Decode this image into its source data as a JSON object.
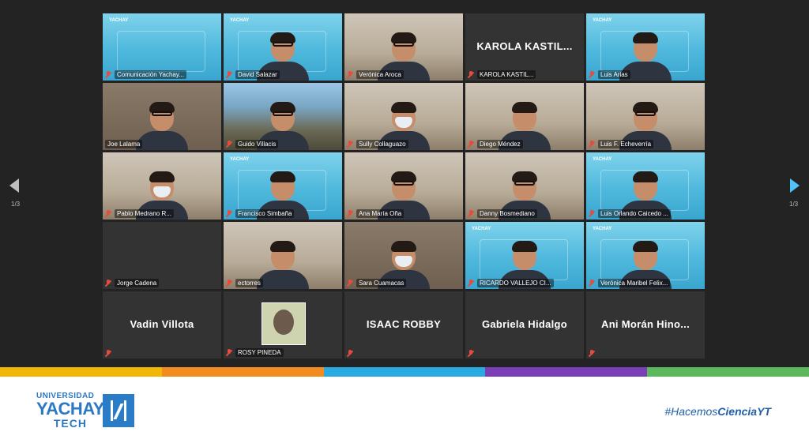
{
  "participants": [
    {
      "name": "Comunicación Yachay...",
      "muted": true,
      "bg": "brand",
      "person": false,
      "logo": true
    },
    {
      "name": "David Salazar",
      "muted": true,
      "bg": "brand",
      "person": true,
      "glasses": true
    },
    {
      "name": "Verónica Aroca",
      "muted": true,
      "bg": "room",
      "person": true,
      "glasses": true
    },
    {
      "name": "KAROLA KASTIL...",
      "muted": true,
      "bg": "dark",
      "person": false,
      "display_name": "KAROLA KASTIL..."
    },
    {
      "name": "Luis Arias",
      "muted": true,
      "bg": "brand",
      "person": true
    },
    {
      "name": "Joe Lalama",
      "muted": false,
      "bg": "office",
      "person": true,
      "glasses": true,
      "active": true
    },
    {
      "name": "Guido Villacis",
      "muted": true,
      "bg": "landscape",
      "person": true,
      "glasses": true
    },
    {
      "name": "Sully Collaguazo",
      "muted": true,
      "bg": "room",
      "person": true,
      "mask": true
    },
    {
      "name": "Diego Méndez",
      "muted": true,
      "bg": "room",
      "person": true
    },
    {
      "name": "Luis F. Echeverría",
      "muted": true,
      "bg": "room",
      "person": true,
      "glasses": true
    },
    {
      "name": "Pablo Medrano R...",
      "muted": true,
      "bg": "room",
      "person": true,
      "mask": true
    },
    {
      "name": "Francisco Simbaña",
      "muted": true,
      "bg": "brand",
      "person": true
    },
    {
      "name": "Ana María Oña",
      "muted": true,
      "bg": "room",
      "person": true,
      "glasses": true
    },
    {
      "name": "Danny Bosmediano",
      "muted": true,
      "bg": "room",
      "person": true,
      "glasses": true
    },
    {
      "name": "Luis Orlando Caicedo ...",
      "muted": true,
      "bg": "brand",
      "person": true
    },
    {
      "name": "Jorge Cadena",
      "muted": true,
      "bg": "dark",
      "person": false
    },
    {
      "name": "ectorres",
      "muted": true,
      "bg": "room",
      "person": true
    },
    {
      "name": "Sara Cuamacas",
      "muted": true,
      "bg": "office",
      "person": true,
      "mask": true
    },
    {
      "name": "RICARDO VALLEJO CI...",
      "muted": true,
      "bg": "brand",
      "person": true
    },
    {
      "name": "Verónica Maribel Felix...",
      "muted": true,
      "bg": "brand",
      "person": true
    },
    {
      "name": "",
      "muted": true,
      "bg": "dark",
      "person": false,
      "display_name": "Vadin Villota"
    },
    {
      "name": "ROSY PINEDA",
      "muted": true,
      "bg": "dark",
      "person": false,
      "thumbnail": true
    },
    {
      "name": "",
      "muted": true,
      "bg": "dark",
      "person": false,
      "display_name": "ISAAC ROBBY"
    },
    {
      "name": "",
      "muted": true,
      "bg": "dark",
      "person": false,
      "display_name": "Gabriela Hidalgo"
    },
    {
      "name": "",
      "muted": true,
      "bg": "dark",
      "person": false,
      "display_name": "Ani Morán Hino..."
    }
  ],
  "pagination": {
    "left_label": "1/3",
    "right_label": "1/3"
  },
  "footer": {
    "logo_line1": "UNIVERSIDAD",
    "logo_line2": "YACHAY",
    "logo_line3": "TECH",
    "hashtag_prefix": "#Hacemos",
    "hashtag_bold": "CienciaYT"
  },
  "mini_logo_text": "YACHAY",
  "colors": {
    "stripe": [
      "#f2b705",
      "#f28c1e",
      "#29abe2",
      "#7a3fb6",
      "#5cb85c"
    ],
    "brand": "#2a7cc7",
    "active_border": "#d6f04a"
  }
}
